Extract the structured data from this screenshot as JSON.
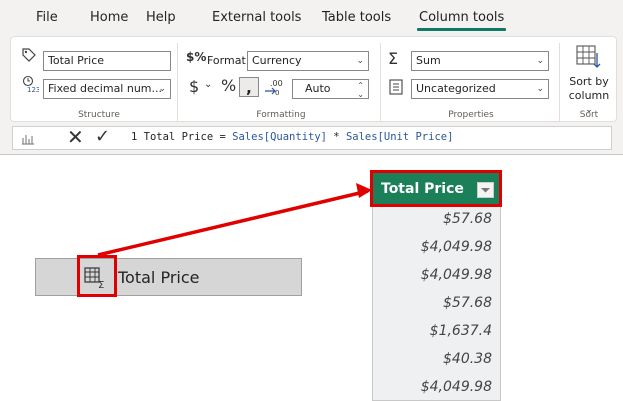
{
  "tabs": [
    {
      "label": "File"
    },
    {
      "label": "Home"
    },
    {
      "label": "Help"
    },
    {
      "label": "External tools"
    },
    {
      "label": "Table tools"
    },
    {
      "label": "Column tools"
    }
  ],
  "structure": {
    "name_value": "Total Price",
    "datatype_value": "Fixed decimal num...",
    "label": "Structure"
  },
  "formatting": {
    "format_label": "Format",
    "format_value": "Currency",
    "decimal_value": "Auto",
    "label": "Formatting"
  },
  "properties": {
    "summarization_value": "Sum",
    "category_value": "Uncategorized",
    "label": "Properties"
  },
  "sort": {
    "button_line1": "Sort by",
    "button_line2": "column",
    "label": "Sort"
  },
  "formula": {
    "line_number": "1",
    "pre": " Total Price = ",
    "ref1": "Sales[Quantity]",
    "op": " * ",
    "ref2": "Sales[Unit Price]"
  },
  "field": {
    "label": "Total Price"
  },
  "table": {
    "header": "Total Price",
    "values": [
      "$57.68",
      "$4,049.98",
      "$4,049.98",
      "$57.68",
      "$1,637.4",
      "$40.38",
      "$4,049.98"
    ]
  },
  "colors": {
    "accent": "#117865",
    "header_green": "#1b7f5a",
    "highlight_red": "#e00000"
  }
}
